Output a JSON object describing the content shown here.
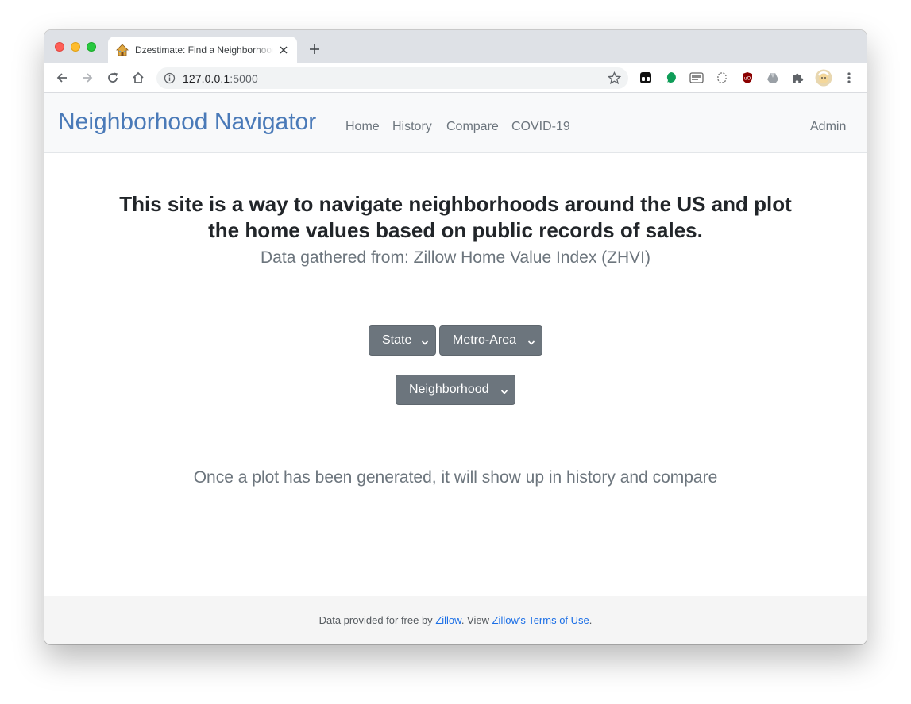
{
  "browser": {
    "tab_title": "Dzestimate: Find a Neighborhood",
    "url_host": "127.0.0.1",
    "url_port": ":5000"
  },
  "navbar": {
    "brand": "Neighborhood Navigator",
    "links": [
      "Home",
      "History",
      "Compare",
      "COVID-19"
    ],
    "admin": "Admin"
  },
  "main": {
    "title": "This site is a way to navigate neighborhoods around the US and plot the home values based on public records of sales.",
    "subtitle": "Data gathered from: Zillow Home Value Index (ZHVI)",
    "selects": {
      "state": "State",
      "metro": "Metro-Area",
      "neighborhood": "Neighborhood"
    },
    "note": "Once a plot has been generated, it will show up in history and compare"
  },
  "footer": {
    "prefix": "Data provided for free by ",
    "zillow_link": "Zillow",
    "middle": ". View ",
    "terms_link": "Zillow's Terms of Use",
    "suffix": "."
  },
  "colors": {
    "brand": "#4a7ab8",
    "select_bg": "#6c757d",
    "link": "#1a6ee6"
  }
}
